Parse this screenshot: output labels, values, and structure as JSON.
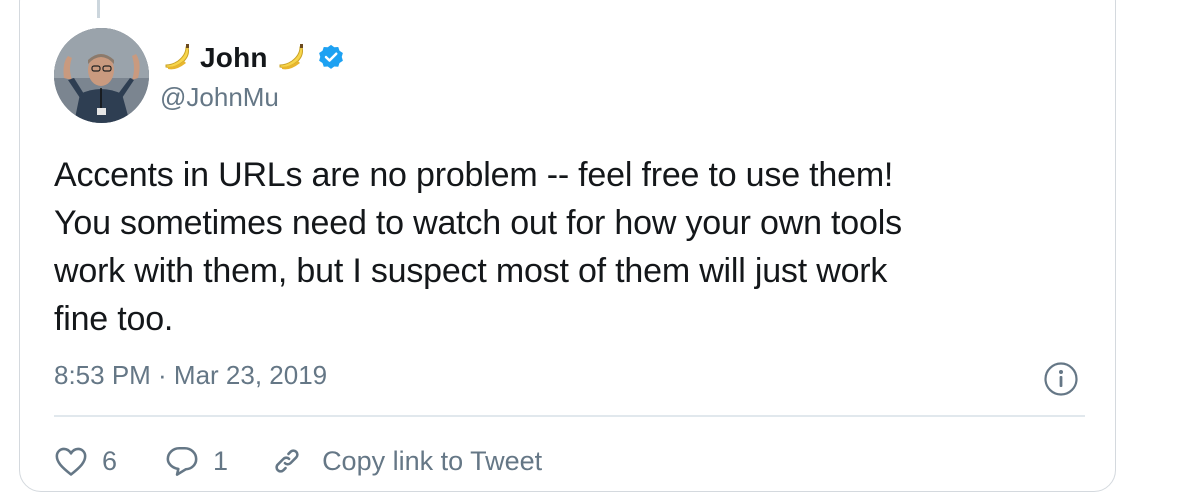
{
  "tweet": {
    "author": {
      "name": "John",
      "handle": "@JohnMu",
      "name_prefix_emoji": "banana-icon",
      "name_suffix_emoji": "banana-icon",
      "verified": true
    },
    "text_lines": [
      "Accents in URLs are no problem -- feel free to use them!",
      "You sometimes need to watch out for how your own tools",
      "work with them, but I suspect most of them will just work",
      "fine too."
    ],
    "timestamp": "8:53 PM · Mar 23, 2019",
    "actions": {
      "likes": "6",
      "replies": "1",
      "copy_link_label": "Copy link to Tweet"
    }
  },
  "colors": {
    "text": "#14171a",
    "secondary": "#657786",
    "verified": "#1da1f2",
    "border": "#d4d9de"
  }
}
